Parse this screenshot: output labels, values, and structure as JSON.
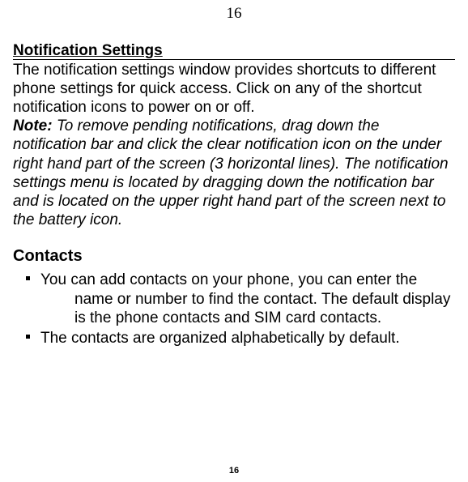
{
  "page": {
    "top_number": "16",
    "footer_number": "16"
  },
  "notification": {
    "heading": "Notification Settings",
    "body": "The notification settings window provides shortcuts to different phone settings for quick access. Click on any of the shortcut notification icons to power on or off.",
    "note_label": "Note:",
    "note_body": " To remove pending notifications, drag down the notification bar and click the clear notification icon on the under right hand part of the screen (3 horizontal lines). The notification settings menu is located by dragging down the notification bar and is located on the upper right hand part of the screen next to the battery icon."
  },
  "contacts": {
    "heading": "Contacts",
    "items": [
      {
        "first": "You can add contacts on your phone, you can enter the",
        "rest": "name or number to find the contact. The default display is the phone contacts and SIM card contacts."
      },
      {
        "first": "The contacts are organized alphabetically by default.",
        "rest": ""
      }
    ]
  }
}
